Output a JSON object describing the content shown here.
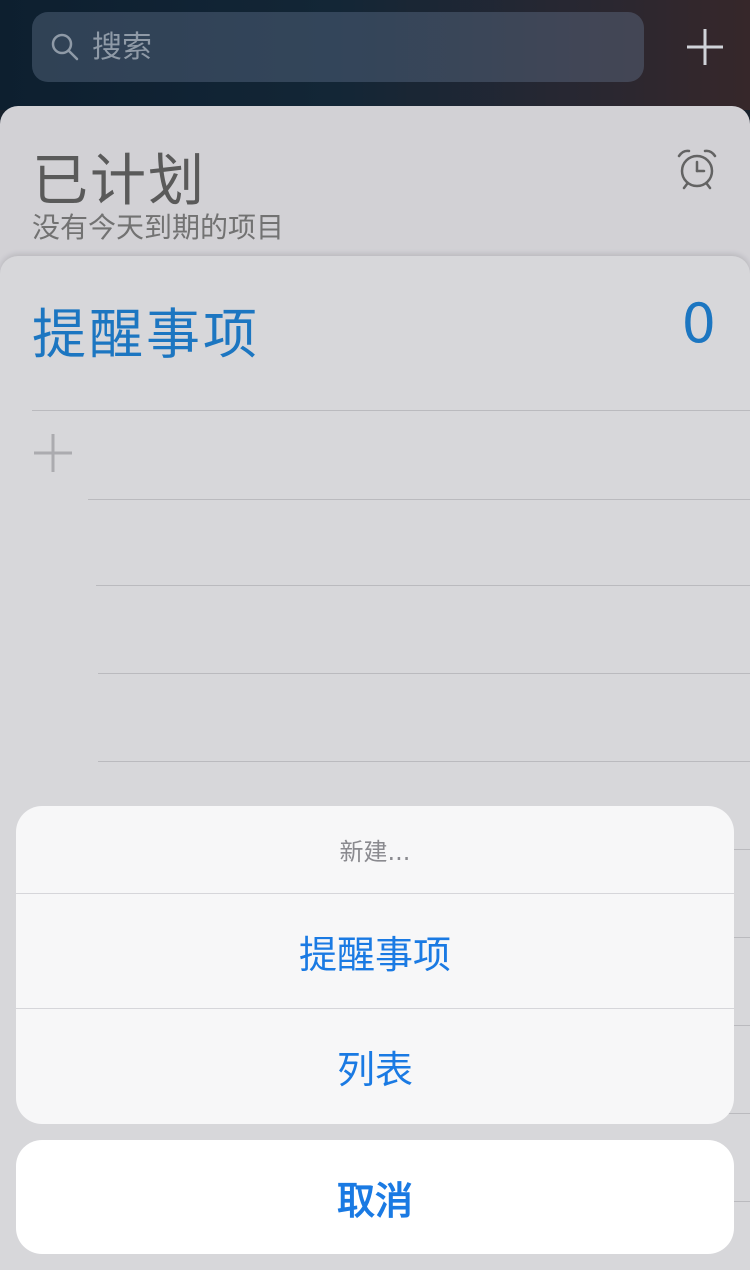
{
  "search": {
    "placeholder": "搜索",
    "icon": "search-icon"
  },
  "header": {
    "add_icon": "plus-icon"
  },
  "scheduled": {
    "title": "已计划",
    "subtitle": "没有今天到期的项目",
    "icon": "alarm-clock-icon"
  },
  "reminders_list": {
    "title": "提醒事项",
    "count": "0",
    "new_item_icon": "plus-icon"
  },
  "action_sheet": {
    "header": "新建...",
    "options": [
      "提醒事项",
      "列表"
    ],
    "cancel": "取消"
  },
  "colors": {
    "accent": "#1a7ae3",
    "list_title": "#1f7fd0"
  }
}
